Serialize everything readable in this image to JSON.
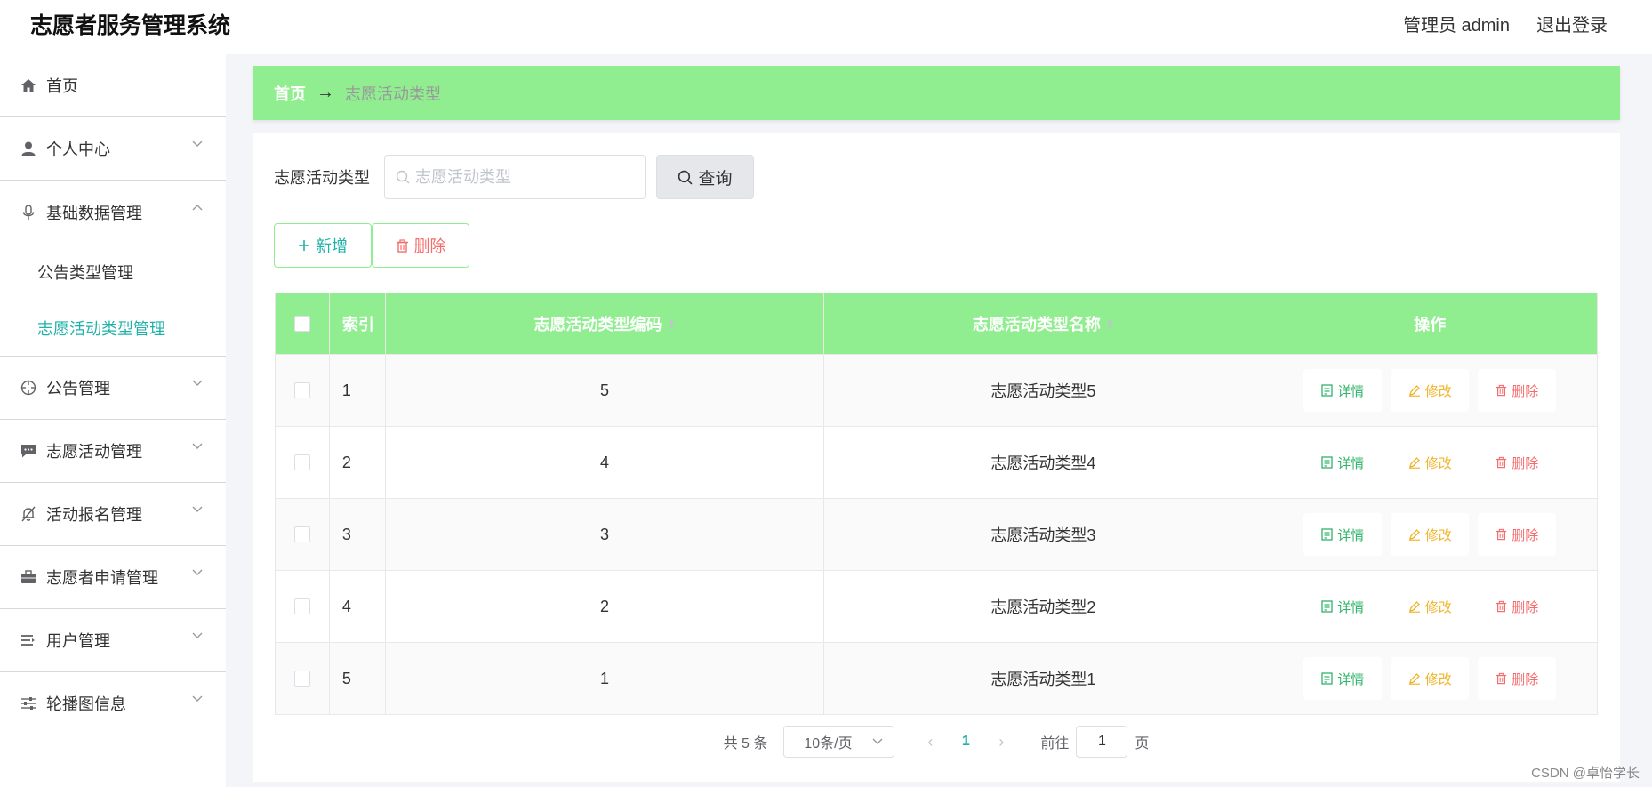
{
  "header": {
    "app_title": "志愿者服务管理系统",
    "user_label": "管理员 admin",
    "logout_label": "退出登录"
  },
  "sidebar": {
    "items": [
      {
        "label": "首页",
        "icon": "home-icon"
      },
      {
        "label": "个人中心",
        "icon": "user-icon"
      },
      {
        "label": "基础数据管理",
        "icon": "microphone-icon"
      },
      {
        "label": "公告管理",
        "icon": "crosshair-icon"
      },
      {
        "label": "志愿活动管理",
        "icon": "chat-icon"
      },
      {
        "label": "活动报名管理",
        "icon": "bell-off-icon"
      },
      {
        "label": "志愿者申请管理",
        "icon": "briefcase-icon"
      },
      {
        "label": "用户管理",
        "icon": "list-icon"
      },
      {
        "label": "轮播图信息",
        "icon": "sliders-icon"
      }
    ],
    "submenu": [
      {
        "label": "公告类型管理"
      },
      {
        "label": "志愿活动类型管理"
      }
    ]
  },
  "breadcrumb": {
    "home": "首页",
    "arrow": "→",
    "current": "志愿活动类型"
  },
  "search": {
    "label": "志愿活动类型",
    "placeholder": "志愿活动类型",
    "query_label": "查询"
  },
  "actions": {
    "add_label": "新增",
    "delete_label": "删除"
  },
  "table": {
    "headers": {
      "index": "索引",
      "code": "志愿活动类型编码",
      "name": "志愿活动类型名称",
      "ops": "操作"
    },
    "rows": [
      {
        "index": "1",
        "code": "5",
        "name": "志愿活动类型5"
      },
      {
        "index": "2",
        "code": "4",
        "name": "志愿活动类型4"
      },
      {
        "index": "3",
        "code": "3",
        "name": "志愿活动类型3"
      },
      {
        "index": "4",
        "code": "2",
        "name": "志愿活动类型2"
      },
      {
        "index": "5",
        "code": "1",
        "name": "志愿活动类型1"
      }
    ],
    "op_labels": {
      "detail": "详情",
      "edit": "修改",
      "delete": "删除"
    }
  },
  "pagination": {
    "total": "共 5 条",
    "page_size": "10条/页",
    "current_page": "1",
    "goto_label": "前往",
    "goto_value": "1",
    "page_suffix": "页"
  },
  "watermark": "CSDN @卓怡学长",
  "colors": {
    "accent_green": "#90ee90",
    "teal": "#20b2aa",
    "danger": "#f56c6c",
    "warning": "#f0b429",
    "success": "#2fb36a"
  }
}
